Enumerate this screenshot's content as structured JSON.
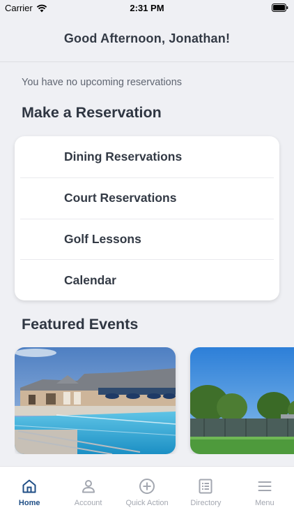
{
  "status_bar": {
    "carrier": "Carrier",
    "time": "2:31 PM"
  },
  "header": {
    "greeting": "Good Afternoon, Jonathan!"
  },
  "reservations": {
    "empty_message": "You have no upcoming reservations",
    "section_title": "Make a Reservation",
    "items": [
      {
        "label": "Dining Reservations"
      },
      {
        "label": "Court Reservations"
      },
      {
        "label": "Golf Lessons"
      },
      {
        "label": "Calendar"
      }
    ]
  },
  "featured": {
    "section_title": "Featured Events"
  },
  "tabs": [
    {
      "label": "Home",
      "icon": "home-icon",
      "active": true
    },
    {
      "label": "Account",
      "icon": "person-icon",
      "active": false
    },
    {
      "label": "Quick Action",
      "icon": "plus-circle-icon",
      "active": false
    },
    {
      "label": "Directory",
      "icon": "list-icon",
      "active": false
    },
    {
      "label": "Menu",
      "icon": "hamburger-icon",
      "active": false
    }
  ],
  "colors": {
    "accent": "#1f4e86",
    "inactive": "#a3a7b0",
    "background": "#eff0f4"
  }
}
